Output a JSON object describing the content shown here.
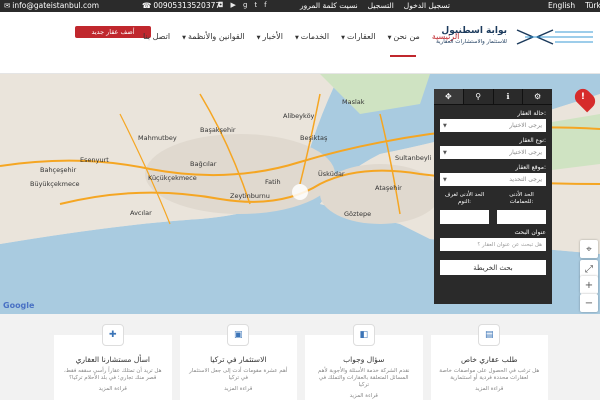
{
  "topbar": {
    "email": "info@gateistanbul.com",
    "phone": "00905313520377",
    "register": "تسجيل الدخول",
    "signup": "التسجيل",
    "forgot": "نسيت كلمة المرور",
    "lang_en": "English",
    "lang_tr": "Türkçe"
  },
  "header": {
    "add_property": "أضف عقار جديد",
    "logo_title": "بوابة اسطنبول",
    "logo_subtitle": "للاستثمار والاستشارات العقارية",
    "nav": [
      "الرئيسية",
      "من نحن",
      "العقارات",
      "الخدمات",
      "الأخبار",
      "القوانين والأنظمة",
      "اتصل بنا"
    ]
  },
  "map": {
    "labels": [
      "Esenyurt",
      "Başakşehir",
      "Maslak",
      "Alibeyköy",
      "Mahmutbey",
      "Üsküdar",
      "Fatih",
      "Ataşehir",
      "Zeytinburnu",
      "Bağcılar",
      "Küçükçekmece",
      "Büyükçekmece",
      "Sultanbeyli",
      "Göztepe",
      "Avcılar",
      "Bahçeşehir",
      "Beşiktaş"
    ],
    "google": "Google",
    "pin_symbol": "!"
  },
  "search_panel": {
    "tabs": [
      "move-icon",
      "search-icon",
      "info-icon",
      "settings-icon"
    ],
    "status_label": "حالة العقار:",
    "status_value": "يرجى الاختيار",
    "type_label": "نوع العقار:",
    "type_value": "يرجى الاختيار",
    "location_label": "موقع العقار:",
    "location_value": "يرجى التحديد",
    "min_rooms_label": "الحد الأدنى لغرف النوم:",
    "min_baths_label": "الحد الأدنى للحمامات:",
    "search_title_label": "عنوان البحث",
    "search_title_placeholder": "هل تبحث عن عنوان العقار ؟",
    "map_button": "بحث الخريطة"
  },
  "cards": [
    {
      "icon": "plus-icon",
      "title": "اسأل مستشارنا العقاري",
      "desc": "هل تريد أن تمتلك عقاراً رأسي سقفه فقط، قصر منك تجاري؛ في بلد الأحلام تركيا؟",
      "more": "قراءة المزيد"
    },
    {
      "icon": "briefcase-icon",
      "title": "الاستثمار في تركيا",
      "desc": "أهم عشرة مقومات أدت إلى جعل الاستثمار في تركيا",
      "more": "قراءة المزيد"
    },
    {
      "icon": "wallet-icon",
      "title": "سؤال وجواب",
      "desc": "نقدم الشركة خدمة الأسئلة والأجوبة لأهم المسائل المتعلقة بالعقارات والتملك في تركيا",
      "more": "قراءة المزيد"
    },
    {
      "icon": "map-icon",
      "title": "طلب عقاري خاص",
      "desc": "هل ترغب في الحصول على مواصفات خاصة لعقارات محددة فردية أو استثمارية",
      "more": "قراءة المزيد"
    }
  ]
}
